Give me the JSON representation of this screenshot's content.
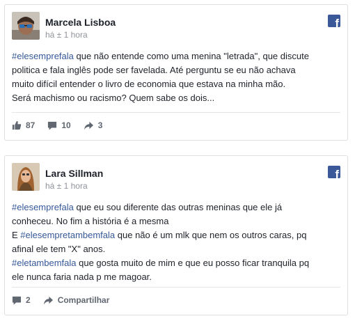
{
  "posts": [
    {
      "author": "Marcela Lisboa",
      "timestamp": "há ± 1 hora",
      "lines": [
        {
          "hashtag": "#elesemprefala",
          "text": " que não entende como uma menina \"letrada\", que discute"
        },
        {
          "hashtag": "",
          "text": "politica e fala inglês pode ser favelada. Até perguntu se eu não achava"
        },
        {
          "hashtag": "",
          "text": "muito difícil entender o livro de economia que estava na minha mão."
        },
        {
          "hashtag": "",
          "text": "Será machismo ou racismo? Quem sabe os dois..."
        }
      ],
      "likes": "87",
      "comments": "10",
      "shares": "3",
      "icons": [
        "like-icon",
        "comment-icon",
        "share-icon",
        "facebook-icon"
      ]
    },
    {
      "author": "Lara Sillman",
      "timestamp": "há ± 1 hora",
      "lines": [
        {
          "hashtag": "#elesemprefala",
          "text": " que eu sou diferente das outras meninas que ele já"
        },
        {
          "hashtag": "",
          "text": "conheceu. No fim a história é a mesma"
        },
        {
          "prefix": "E ",
          "hashtag": "#elesempretambemfala",
          "text": " que não é um mlk que nem os outros caras, pq"
        },
        {
          "hashtag": "",
          "text": "afinal ele tem \"X\" anos."
        },
        {
          "hashtag": "#eletambemfala",
          "text": " que gosta muito de mim e que eu posso ficar tranquila pq"
        },
        {
          "hashtag": "",
          "text": "ele nunca faria nada p me magoar."
        }
      ],
      "comments": "2",
      "share_label": "Compartilhar",
      "icons": [
        "comment-icon",
        "share-icon",
        "facebook-icon"
      ]
    }
  ],
  "colors": {
    "hashtag": "#365899",
    "facebook_blue": "#3b5998",
    "meta_gray": "#90949c",
    "action_gray": "#606770"
  }
}
